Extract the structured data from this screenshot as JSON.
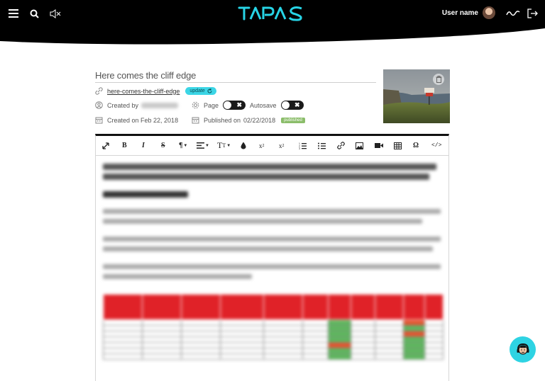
{
  "header": {
    "logo_text": "TAPAS",
    "user_name": "User name",
    "icons": [
      "menu-icon",
      "search-icon",
      "mute-icon",
      "wave-icon",
      "logout-icon"
    ]
  },
  "page": {
    "title": "Here comes the cliff edge",
    "slug": "here-comes-the-cliff-edge",
    "update_label": "update",
    "created_by_label": "Created by",
    "page_label": "Page",
    "autosave_label": "Autosave",
    "created_on": "Created on Feb 22, 2018",
    "published_on_label": "Published on",
    "published_on_date": "02/22/2018",
    "status": "published"
  },
  "toolbar": {
    "paragraph": "¶",
    "text_size": "T",
    "omega": "Ω",
    "code": "</>"
  },
  "colors": {
    "accent": "#2ed3e3",
    "header_bg": "#000000",
    "published": "#8bbd6a",
    "table_header": "#e02228"
  }
}
